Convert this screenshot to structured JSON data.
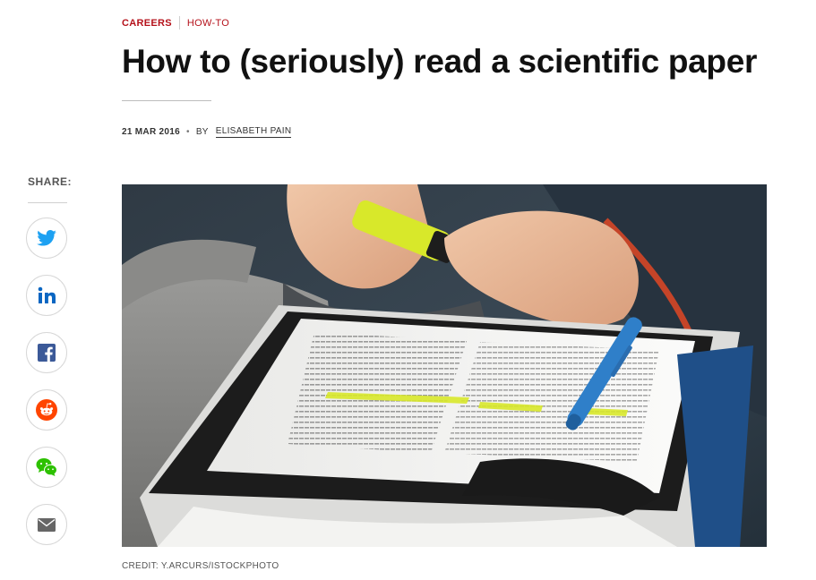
{
  "breadcrumb": {
    "section": "CAREERS",
    "subsection": "HOW-TO"
  },
  "article": {
    "title": "How to (seriously) read a scientific paper",
    "date": "21 MAR 2016",
    "dot": "•",
    "by": "BY",
    "author": "ELISABETH PAIN",
    "credit": "CREDIT: Y.ARCURS/ISTOCKPHOTO"
  },
  "share": {
    "label": "SHARE:",
    "buttons": [
      {
        "icon": "twitter-icon",
        "color": "#1da1f2"
      },
      {
        "icon": "linkedin-icon",
        "color": "#0a66c2"
      },
      {
        "icon": "facebook-icon",
        "color": "#3b5998"
      },
      {
        "icon": "reddit-icon",
        "color": "#ff4500"
      },
      {
        "icon": "wechat-icon",
        "color": "#2dc100"
      },
      {
        "icon": "email-icon",
        "color": "#666666"
      }
    ]
  },
  "colors": {
    "accent": "#b5121b",
    "highlighter": "#d8e82a",
    "pen": "#2f7fc9"
  }
}
